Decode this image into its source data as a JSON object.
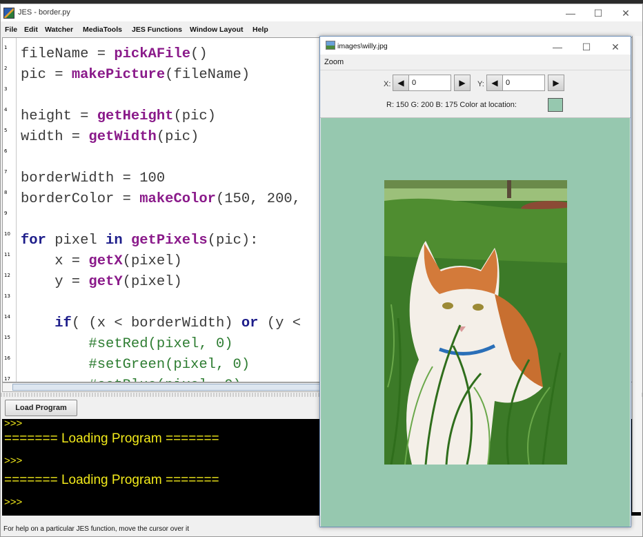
{
  "jes": {
    "title": "JES - border.py",
    "menu": [
      "File",
      "Edit",
      "Watcher",
      "MediaTools",
      "JES Functions",
      "Window Layout",
      "Help"
    ]
  },
  "editor": {
    "line_numbers": [
      "1",
      "2",
      "3",
      "4",
      "5",
      "6",
      "7",
      "8",
      "9",
      "10",
      "11",
      "12",
      "13",
      "14",
      "15",
      "16",
      "17"
    ],
    "lines": [
      [
        {
          "t": "fileName = ",
          "c": ""
        },
        {
          "t": "pickAFile",
          "c": "fn"
        },
        {
          "t": "()",
          "c": ""
        }
      ],
      [
        {
          "t": "pic = ",
          "c": ""
        },
        {
          "t": "makePicture",
          "c": "fn"
        },
        {
          "t": "(fileName)",
          "c": ""
        }
      ],
      [],
      [
        {
          "t": "height = ",
          "c": ""
        },
        {
          "t": "getHeight",
          "c": "fn"
        },
        {
          "t": "(pic)",
          "c": ""
        }
      ],
      [
        {
          "t": "width = ",
          "c": ""
        },
        {
          "t": "getWidth",
          "c": "fn"
        },
        {
          "t": "(pic)",
          "c": ""
        }
      ],
      [],
      [
        {
          "t": "borderWidth = 100",
          "c": ""
        }
      ],
      [
        {
          "t": "borderColor = ",
          "c": ""
        },
        {
          "t": "makeColor",
          "c": "fn"
        },
        {
          "t": "(150, 200,",
          "c": ""
        }
      ],
      [],
      [
        {
          "t": "for",
          "c": "kw"
        },
        {
          "t": " pixel ",
          "c": ""
        },
        {
          "t": "in",
          "c": "kw"
        },
        {
          "t": " ",
          "c": ""
        },
        {
          "t": "getPixels",
          "c": "fn"
        },
        {
          "t": "(pic):",
          "c": ""
        }
      ],
      [
        {
          "t": "    x = ",
          "c": ""
        },
        {
          "t": "getX",
          "c": "fn"
        },
        {
          "t": "(pixel)",
          "c": ""
        }
      ],
      [
        {
          "t": "    y = ",
          "c": ""
        },
        {
          "t": "getY",
          "c": "fn"
        },
        {
          "t": "(pixel)",
          "c": ""
        }
      ],
      [],
      [
        {
          "t": "    ",
          "c": ""
        },
        {
          "t": "if",
          "c": "kw"
        },
        {
          "t": "( (x < borderWidth) ",
          "c": ""
        },
        {
          "t": "or",
          "c": "kw"
        },
        {
          "t": " (y < ",
          "c": ""
        }
      ],
      [
        {
          "t": "        #setRed(pixel, 0)",
          "c": "cm"
        }
      ],
      [
        {
          "t": "        #setGreen(pixel, 0)",
          "c": "cm"
        }
      ],
      [
        {
          "t": "        #setBlue(pixel, 0)",
          "c": "cm"
        }
      ]
    ]
  },
  "load_button": "Load Program",
  "console": [
    {
      "text": ">>>",
      "small": true
    },
    {
      "text": "======= Loading Program =======",
      "small": false
    },
    {
      "text": ">>>",
      "small": true
    },
    {
      "text": "======= Loading Program =======",
      "small": false
    },
    {
      "text": ">>>",
      "small": true
    }
  ],
  "status": "For help on a particular JES function, move the cursor over it",
  "image_window": {
    "title": "images\\willy.jpg",
    "menu_zoom": "Zoom",
    "x_label": "X:",
    "y_label": "Y:",
    "x_value": "0",
    "y_value": "0",
    "rgb_text": "R: 150 G: 200 B: 175 Color at location:",
    "swatch_color": "#96c8af",
    "border_color": "#96c8af"
  },
  "colors": {
    "keyword": "#1d1d8a",
    "function": "#8a1a8a",
    "comment": "#2e7d32",
    "console_text": "#f2ea1a"
  }
}
